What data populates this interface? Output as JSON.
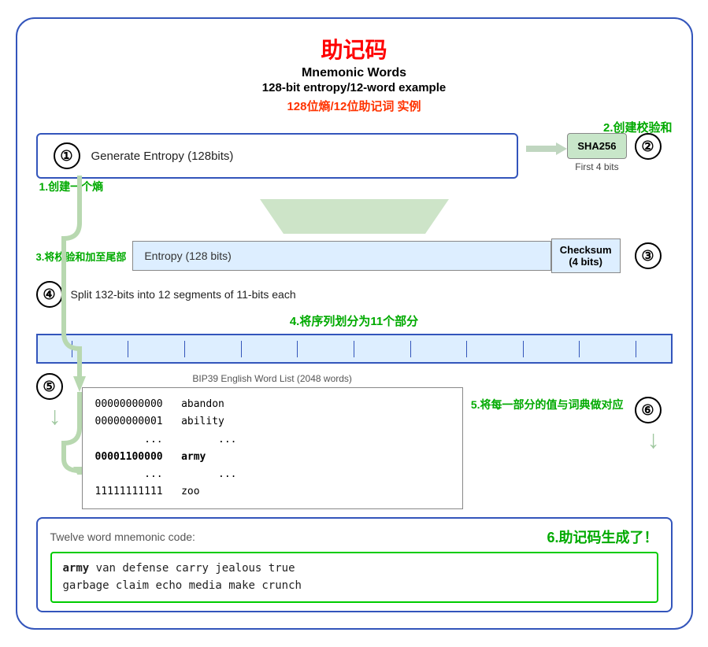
{
  "title_cn": "助记码",
  "title_en": "Mnemonic Words",
  "subtitle_en": "128-bit entropy/12-word example",
  "subtitle_cn": "128位熵/12位助记词 实例",
  "step2_label": "2.创建校验和",
  "step1_label": "1.创建一个熵",
  "step1_circle": "①",
  "step1_text": "Generate Entropy (128bits)",
  "sha_label": "SHA256",
  "first4_label": "First 4 bits",
  "step2_circle": "②",
  "step3_label": "3.将校验和加至尾部",
  "step3_entropy": "Entropy (128 bits)",
  "checksum_label": "Checksum\n(4 bits)",
  "step3_circle": "③",
  "step4_circle": "④",
  "step4_text": "Split 132-bits into 12 segments of 11-bits each",
  "step4_cn": "4.将序列划分为11个部分",
  "wordlist_label": "BIP39 English Word List (2048 words)",
  "step5_circle": "⑤",
  "wordlist_lines": [
    {
      "binary": "00000000000",
      "word": "abandon",
      "bold": false
    },
    {
      "binary": "00000000001",
      "word": "ability",
      "bold": false
    },
    {
      "binary": "...",
      "word": "...",
      "bold": false
    },
    {
      "binary": "00001100000",
      "word": "army",
      "bold": true
    },
    {
      "binary": "...",
      "word": "...",
      "bold": false
    },
    {
      "binary": "11111111111",
      "word": "zoo",
      "bold": false
    }
  ],
  "step5_label": "5.将每一部分的值与词典做对应",
  "step6_circle": "⑥",
  "step6_label": "Twelve word mnemonic code:",
  "step6_cn": "6.助记码生成了！",
  "mnemonic_line1": "army van defense carry jealous true",
  "mnemonic_line2": "garbage claim echo media make crunch",
  "mnemonic_bold": "army"
}
